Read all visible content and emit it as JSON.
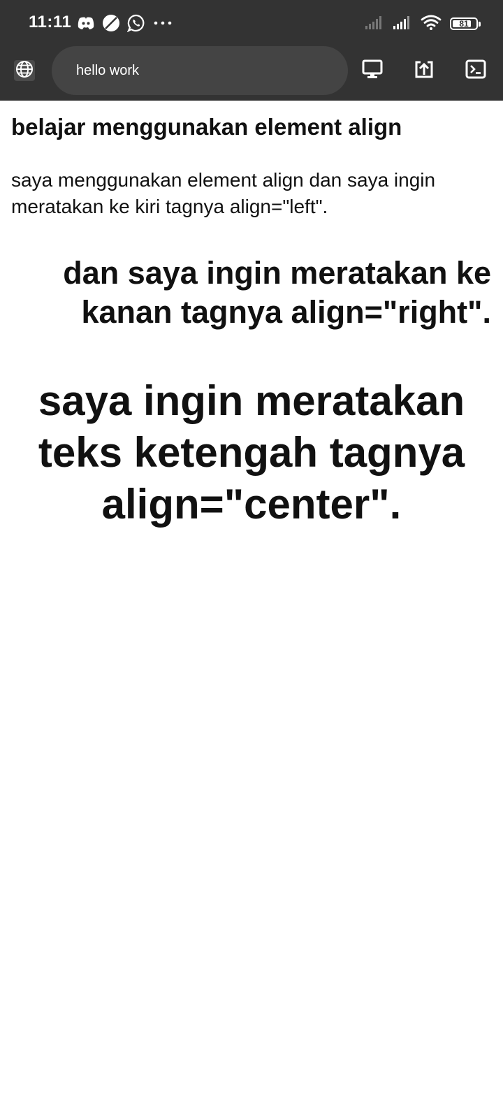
{
  "status_bar": {
    "time": "11:11",
    "battery_level": "81",
    "battery_fraction": 0.81,
    "icons_left": [
      "discord-icon",
      "no-disturb-icon",
      "whatsapp-icon",
      "more-icon"
    ],
    "icons_right": [
      "signal-icon",
      "signal-icon",
      "wifi-icon",
      "battery-icon"
    ]
  },
  "toolbar": {
    "url_text": "hello work",
    "buttons": [
      "desktop-icon",
      "share-icon",
      "console-icon"
    ]
  },
  "page": {
    "heading": "belajar menggunakan element align",
    "left_paragraph": "saya menggunakan element align dan saya ingin meratakan ke kiri tagnya align=\"left\".",
    "right_heading": "dan saya ingin meratakan ke kanan tagnya align=\"right\".",
    "center_heading": "saya ingin meratakan teks ketengah tagnya align=\"center\"."
  },
  "colors": {
    "chrome": "#333333",
    "url_bar": "#444444",
    "text": "#111111",
    "background": "#ffffff"
  }
}
